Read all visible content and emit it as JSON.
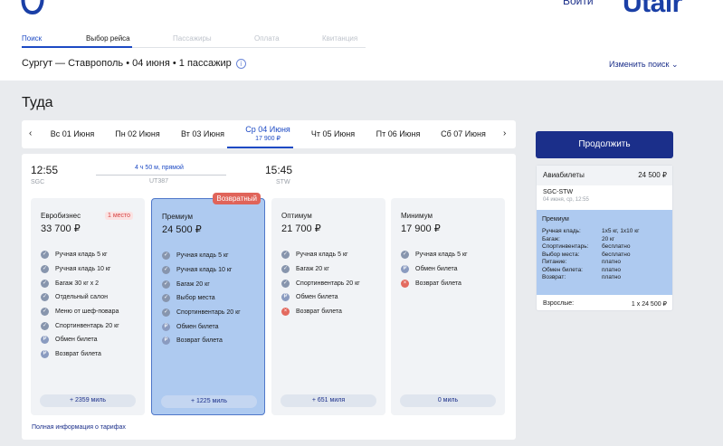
{
  "header": {
    "login_label": "Войти",
    "brand": "Utair",
    "steps": [
      "Поиск",
      "Выбор рейса",
      "Пассажиры",
      "Оплата",
      "Квитанция"
    ],
    "search_summary": "Сургут — Ставрополь • 04 июня • 1 пассажир",
    "change_search_label": "Изменить поиск",
    "info_glyph": "i",
    "chevron_glyph": "⌄"
  },
  "direction_title": "Туда",
  "dates": {
    "prev_glyph": "‹",
    "next_glyph": "›",
    "items": [
      {
        "label": "Вс 01 Июня",
        "price": ""
      },
      {
        "label": "Пн 02 Июня",
        "price": ""
      },
      {
        "label": "Вт 03 Июня",
        "price": ""
      },
      {
        "label": "Ср 04 Июня",
        "price": "17 900 ₽"
      },
      {
        "label": "Чт 05 Июня",
        "price": ""
      },
      {
        "label": "Пт 06 Июня",
        "price": ""
      },
      {
        "label": "Сб 07 Июня",
        "price": ""
      }
    ]
  },
  "flight": {
    "dep_time": "12:55",
    "dep_code": "SGC",
    "arr_time": "15:45",
    "arr_code": "STW",
    "duration": "4 ч 50 м, прямой",
    "flight_number": "UT387"
  },
  "tariffs": [
    {
      "name": "Евробизнес",
      "price": "33 700 ₽",
      "badge": "1 место",
      "tag": "",
      "features": [
        {
          "icon": "check-icon",
          "glyph": "✓",
          "kind": "inc",
          "text": "Ручная кладь 5 кг"
        },
        {
          "icon": "check-icon",
          "glyph": "✓",
          "kind": "inc",
          "text": "Ручная кладь 10 кг"
        },
        {
          "icon": "check-icon",
          "glyph": "✓",
          "kind": "inc",
          "text": "Багаж 30 кг x 2"
        },
        {
          "icon": "check-icon",
          "glyph": "✓",
          "kind": "inc",
          "text": "Отдельный салон"
        },
        {
          "icon": "check-icon",
          "glyph": "✓",
          "kind": "inc",
          "text": "Меню от шеф-повара"
        },
        {
          "icon": "check-icon",
          "glyph": "✓",
          "kind": "inc",
          "text": "Спортинвентарь 20 кг"
        },
        {
          "icon": "paid-icon",
          "glyph": "₽",
          "kind": "paid",
          "text": "Обмен билета"
        },
        {
          "icon": "paid-icon",
          "glyph": "₽",
          "kind": "paid",
          "text": "Возврат билета"
        }
      ],
      "miles": "+ 2359 миль"
    },
    {
      "name": "Премиум",
      "price": "24 500 ₽",
      "badge": "",
      "tag": "Возвратный",
      "features": [
        {
          "icon": "check-icon",
          "glyph": "✓",
          "kind": "inc",
          "text": "Ручная кладь 5 кг"
        },
        {
          "icon": "check-icon",
          "glyph": "✓",
          "kind": "inc",
          "text": "Ручная кладь 10 кг"
        },
        {
          "icon": "check-icon",
          "glyph": "✓",
          "kind": "inc",
          "text": "Багаж 20 кг"
        },
        {
          "icon": "check-icon",
          "glyph": "✓",
          "kind": "inc",
          "text": "Выбор места"
        },
        {
          "icon": "check-icon",
          "glyph": "✓",
          "kind": "inc",
          "text": "Спортинвентарь 20 кг"
        },
        {
          "icon": "paid-icon",
          "glyph": "₽",
          "kind": "paid",
          "text": "Обмен билета"
        },
        {
          "icon": "paid-icon",
          "glyph": "₽",
          "kind": "paid",
          "text": "Возврат билета"
        }
      ],
      "miles": "+ 1225 миль"
    },
    {
      "name": "Оптимум",
      "price": "21 700 ₽",
      "badge": "",
      "tag": "",
      "features": [
        {
          "icon": "check-icon",
          "glyph": "✓",
          "kind": "inc",
          "text": "Ручная кладь 5 кг"
        },
        {
          "icon": "check-icon",
          "glyph": "✓",
          "kind": "inc",
          "text": "Багаж 20 кг"
        },
        {
          "icon": "check-icon",
          "glyph": "✓",
          "kind": "inc",
          "text": "Спортинвентарь 20 кг"
        },
        {
          "icon": "paid-icon",
          "glyph": "₽",
          "kind": "paid",
          "text": "Обмен билета"
        },
        {
          "icon": "cross-icon",
          "glyph": "×",
          "kind": "no",
          "text": "Возврат билета"
        }
      ],
      "miles": "+ 651 миля"
    },
    {
      "name": "Минимум",
      "price": "17 900 ₽",
      "badge": "",
      "tag": "",
      "features": [
        {
          "icon": "check-icon",
          "glyph": "✓",
          "kind": "inc",
          "text": "Ручная кладь 5 кг"
        },
        {
          "icon": "paid-icon",
          "glyph": "₽",
          "kind": "paid",
          "text": "Обмен билета"
        },
        {
          "icon": "cross-icon",
          "glyph": "×",
          "kind": "no",
          "text": "Возврат билета"
        }
      ],
      "miles": "0 миль"
    }
  ],
  "full_info_label": "Полная информация о тарифах",
  "sidebar": {
    "continue_label": "Продолжить",
    "tickets_label": "Авиабилеты",
    "tickets_total": "24 500 ₽",
    "segment": "SGC-STW",
    "segment_date": "04 июня, ср, 12:55",
    "tariff_name": "Премиум",
    "rows": [
      {
        "k": "Ручная кладь:",
        "v": "1x5 кг, 1x10 кг"
      },
      {
        "k": "Багаж:",
        "v": "20 кг"
      },
      {
        "k": "Спортинвентарь:",
        "v": "бесплатно"
      },
      {
        "k": "Выбор места:",
        "v": "бесплатно"
      },
      {
        "k": "Питание:",
        "v": "платно"
      },
      {
        "k": "Обмен билета:",
        "v": "платно"
      },
      {
        "k": "Возврат:",
        "v": "платно"
      }
    ],
    "pax_label": "Взрослые:",
    "pax_value": "1 x 24 500 ₽"
  },
  "colors": {
    "accent": "#1d4ac4",
    "brand": "#1b2f8a",
    "selected": "#aecaf0",
    "danger": "#e36a5f"
  }
}
